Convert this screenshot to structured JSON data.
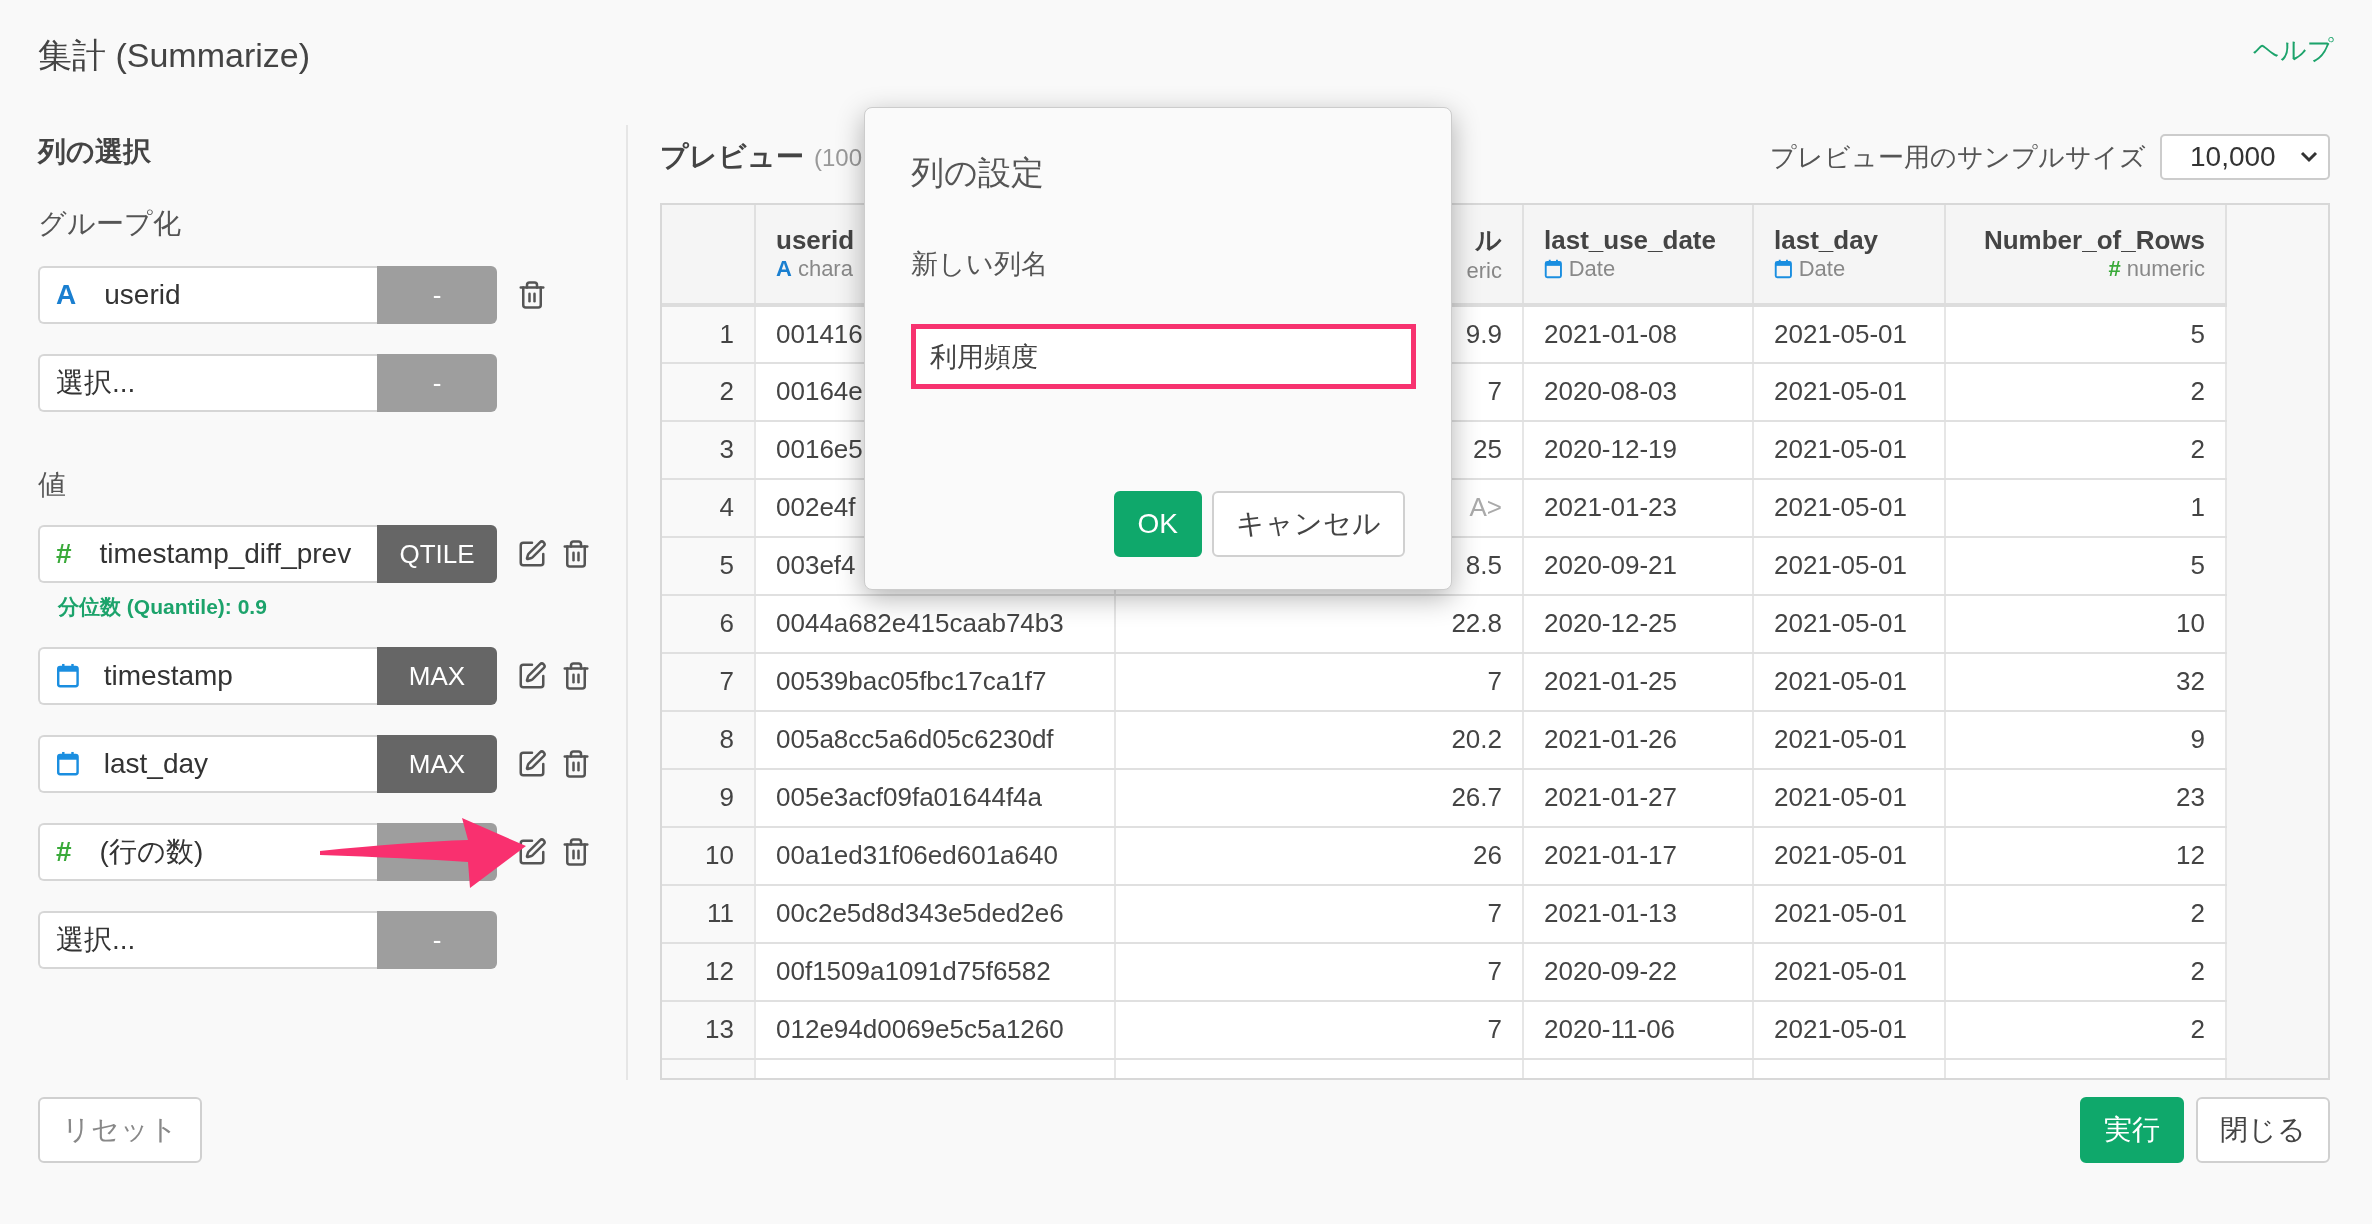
{
  "title": "集計 (Summarize)",
  "help_link": "ヘルプ",
  "column_selection": {
    "heading": "列の選択",
    "group_label": "グループ化",
    "group_rows": [
      {
        "kind": "column",
        "icon": {
          "kind": "glyph",
          "glyph": "A",
          "color": "#1a7fd0"
        },
        "name": "userid",
        "func": "-",
        "func_set": false,
        "editable": false,
        "deletable": true
      },
      {
        "kind": "select",
        "placeholder": "選択...",
        "func": "-",
        "func_set": false,
        "editable": false,
        "deletable": false
      }
    ],
    "value_label": "値",
    "value_rows": [
      {
        "kind": "column",
        "icon": {
          "kind": "glyph",
          "glyph": "#",
          "color": "#3aaa3a"
        },
        "name": "timestamp_diff_prev",
        "func": "QTILE",
        "func_set": true,
        "editable": true,
        "deletable": true,
        "note": "分位数 (Quantile): 0.9"
      },
      {
        "kind": "column",
        "icon": {
          "kind": "calendar"
        },
        "name": "timestamp",
        "func": "MAX",
        "func_set": true,
        "editable": true,
        "deletable": true
      },
      {
        "kind": "column",
        "icon": {
          "kind": "calendar"
        },
        "name": "last_day",
        "func": "MAX",
        "func_set": true,
        "editable": true,
        "deletable": true
      },
      {
        "kind": "column",
        "icon": {
          "kind": "glyph",
          "glyph": "#",
          "color": "#3aaa3a"
        },
        "name": "(行の数)",
        "func_set": false,
        "editable": true,
        "deletable": true
      },
      {
        "kind": "select",
        "placeholder": "選択...",
        "func": "-",
        "func_set": false,
        "editable": false,
        "deletable": false
      }
    ]
  },
  "preview": {
    "title": "プレビュー",
    "count": "(100",
    "sample_label": "プレビュー用のサンプルサイズ",
    "sample_size": "10,000",
    "table": {
      "columns": [
        {
          "name": "userid",
          "icon": {
            "kind": "glyph",
            "glyph": "A",
            "color": "#1a7fd0"
          },
          "type_label": "chara"
        },
        {
          "name": "ル",
          "type_label": "eric"
        },
        {
          "name": "last_use_date",
          "icon": {
            "kind": "calendar"
          },
          "type_label": "Date"
        },
        {
          "name": "last_day",
          "icon": {
            "kind": "calendar"
          },
          "type_label": "Date"
        },
        {
          "name": "Number_of_Rows",
          "icon": {
            "kind": "glyph",
            "glyph": "#",
            "color": "#3aaa3a"
          },
          "type_label": "numeric"
        }
      ],
      "rows": [
        {
          "index": "1",
          "cells": [
            "001416",
            "9.9",
            "2021-01-08",
            "2021-05-01",
            "5"
          ],
          "value_missing": false
        },
        {
          "index": "2",
          "cells": [
            "00164e",
            "7",
            "2020-08-03",
            "2021-05-01",
            "2"
          ],
          "value_missing": false
        },
        {
          "index": "3",
          "cells": [
            "0016e5",
            "25",
            "2020-12-19",
            "2021-05-01",
            "2"
          ],
          "value_missing": false
        },
        {
          "index": "4",
          "cells": [
            "002e4f",
            "A>",
            "2021-01-23",
            "2021-05-01",
            "1"
          ],
          "value_missing": true
        },
        {
          "index": "5",
          "cells": [
            "003ef4",
            "8.5",
            "2020-09-21",
            "2021-05-01",
            "5"
          ],
          "value_missing": false
        },
        {
          "index": "6",
          "cells": [
            "0044a682e415caab74b3",
            "22.8",
            "2020-12-25",
            "2021-05-01",
            "10"
          ],
          "value_missing": false
        },
        {
          "index": "7",
          "cells": [
            "00539bac05fbc17ca1f7",
            "7",
            "2021-01-25",
            "2021-05-01",
            "32"
          ],
          "value_missing": false
        },
        {
          "index": "8",
          "cells": [
            "005a8cc5a6d05c6230df",
            "20.2",
            "2021-01-26",
            "2021-05-01",
            "9"
          ],
          "value_missing": false
        },
        {
          "index": "9",
          "cells": [
            "005e3acf09fa01644f4a",
            "26.7",
            "2021-01-27",
            "2021-05-01",
            "23"
          ],
          "value_missing": false
        },
        {
          "index": "10",
          "cells": [
            "00a1ed31f06ed601a640",
            "26",
            "2021-01-17",
            "2021-05-01",
            "12"
          ],
          "value_missing": false
        },
        {
          "index": "11",
          "cells": [
            "00c2e5d8d343e5ded2e6",
            "7",
            "2021-01-13",
            "2021-05-01",
            "2"
          ],
          "value_missing": false
        },
        {
          "index": "12",
          "cells": [
            "00f1509a1091d75f6582",
            "7",
            "2020-09-22",
            "2021-05-01",
            "2"
          ],
          "value_missing": false
        },
        {
          "index": "13",
          "cells": [
            "012e94d0069e5c5a1260",
            "7",
            "2020-11-06",
            "2021-05-01",
            "2"
          ],
          "value_missing": false
        }
      ]
    }
  },
  "dialog": {
    "title": "列の設定",
    "field_label": "新しい列名",
    "field_value": "利用頻度",
    "ok": "OK",
    "cancel": "キャンセル"
  },
  "footer": {
    "reset": "リセット",
    "run": "実行",
    "close": "閉じる"
  }
}
